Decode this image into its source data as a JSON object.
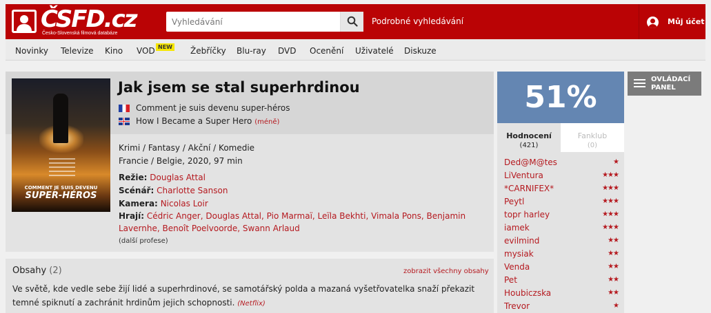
{
  "header": {
    "logo_text": "ČSFD.cz",
    "logo_subtitle": "Česko-Slovenská filmová databáze",
    "search_placeholder": "Vyhledávání",
    "advanced_search": "Podrobné vyhledávání",
    "account_label": "Můj účet"
  },
  "nav": {
    "items": [
      "Novinky",
      "Televize",
      "Kino",
      "VOD",
      "Žebříčky",
      "Blu-ray",
      "DVD",
      "Ocenění",
      "Uživatelé",
      "Diskuze"
    ],
    "vod_badge": "NEW"
  },
  "film": {
    "title": "Jak jsem se stal superhrdinou",
    "alt_titles": [
      {
        "flag": "france",
        "text": "Comment je suis devenu super-héros"
      },
      {
        "flag": "uk",
        "text": "How I Became a Super Hero"
      }
    ],
    "less_link": "(méně)",
    "genres": "Krimi / Fantasy / Akční / Komedie",
    "origin": "Francie / Belgie, 2020, 97 min",
    "director_label": "Režie:",
    "director": "Douglas Attal",
    "writer_label": "Scénář:",
    "writer": "Charlotte Sanson",
    "camera_label": "Kamera:",
    "camera": "Nicolas Loir",
    "cast_label": "Hrají:",
    "cast_line1": "Cédric Anger, Douglas Attal, Pio Marmaï, Leïla Bekhti, Vimala Pons, Benjamin",
    "cast_line2": "Lavernhe, Benoît Poelvoorde, Swann Arlaud",
    "more_professions": "(další profese)",
    "poster": {
      "title_small": "COMMENT JE SUIS DEVENU",
      "title_big": "SUPER-HÉROS"
    }
  },
  "plot": {
    "heading": "Obsahy",
    "count": "(2)",
    "show_all": "zobrazit všechny obsahy",
    "text": "Ve světě, kde vedle sebe žijí lidé a superhrdinové, se samotářský polda a mazaná vyšetřovatelka snaží překazit temné spiknutí a zachránit hrdinům jejich schopnosti.",
    "source": "(Netflix)"
  },
  "rating": {
    "percent": "51%",
    "tab_ratings": "Hodnocení",
    "tab_ratings_count": "(421)",
    "tab_fanclub": "Fanklub",
    "tab_fanclub_count": "(0)",
    "users": [
      {
        "name": "Ded@M@tes",
        "stars": "★"
      },
      {
        "name": "LiVentura",
        "stars": "★★★"
      },
      {
        "name": "*CARNIFEX*",
        "stars": "★★★"
      },
      {
        "name": "Peytl",
        "stars": "★★★"
      },
      {
        "name": "topr harley",
        "stars": "★★★"
      },
      {
        "name": "iamek",
        "stars": "★★★"
      },
      {
        "name": "evilmind",
        "stars": "★★"
      },
      {
        "name": "mysiak",
        "stars": "★★"
      },
      {
        "name": "Venda",
        "stars": "★★"
      },
      {
        "name": "Pet",
        "stars": "★★"
      },
      {
        "name": "Houbiczska",
        "stars": "★★"
      },
      {
        "name": "Trevor",
        "stars": "★"
      }
    ]
  },
  "control_panel": {
    "line1": "OVLÁDACÍ",
    "line2": "PANEL"
  },
  "colors": {
    "brand_red": "#ba0305",
    "rating_blue": "#6486b2",
    "link_red": "#b5191f"
  }
}
